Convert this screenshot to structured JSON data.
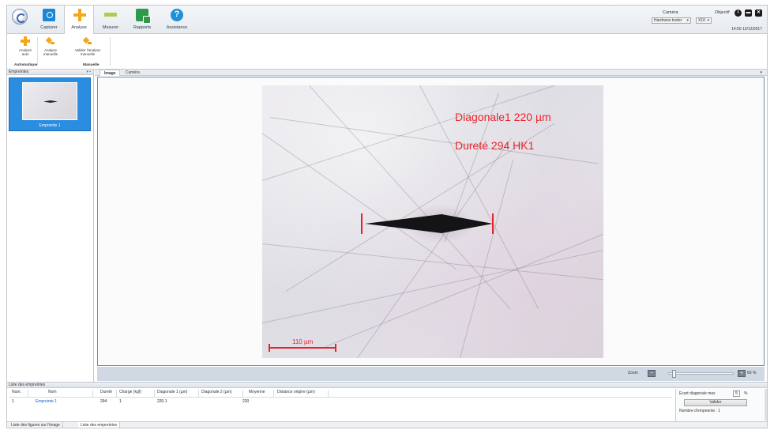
{
  "main_tabs": [
    {
      "label": "Capturer",
      "icon": "camera-icon"
    },
    {
      "label": "Analyse",
      "icon": "crosshair-icon"
    },
    {
      "label": "Mesurer",
      "icon": "ruler-icon"
    },
    {
      "label": "Rapports",
      "icon": "report-icon"
    },
    {
      "label": "Assistance",
      "icon": "help-icon"
    }
  ],
  "header": {
    "camera_label": "Caméra",
    "camera_value": "Hardness tester",
    "objectif_label": "Objectif",
    "objectif_value": "X10",
    "timestamp": "14:50 12/12/2017"
  },
  "ribbon": {
    "buttons": [
      {
        "label": "Analyse\nauto",
        "icon": "auto-analysis-icon"
      },
      {
        "label": "Analyse\nmanuelle",
        "icon": "manual-analysis-icon"
      },
      {
        "label": "Valider l'analyse\nmanuelle",
        "icon": "validate-analysis-icon"
      }
    ],
    "groups": [
      "Automatique",
      "Manuelle"
    ]
  },
  "left_panel": {
    "title": "Empreintes",
    "thumbnail_label": "Empreinte 1"
  },
  "image_tabs": [
    "Image",
    "Caméra"
  ],
  "image_overlay": {
    "line1": "Diagonale1 220 µm",
    "line2": "Dureté 294 HK1",
    "scale_label": "110 µm"
  },
  "zoom": {
    "label": "Zoom",
    "minus": "−",
    "plus": "+",
    "percent_text": "60 %",
    "level": 0.05
  },
  "bottom": {
    "title": "Liste des empreintes",
    "columns": [
      "Num.",
      "Nom",
      "Dureté",
      "Charge (kgf)",
      "Diagonale 1 (µm)",
      "Diagonale 2 (µm)",
      "Moyenne",
      "Distance origine (µm)"
    ],
    "rows": [
      [
        "1",
        "Empreinte 1",
        "294",
        "1",
        "220.1",
        "",
        "220",
        ""
      ]
    ],
    "ecart_label": "Ecart diagonale max",
    "ecart_value": "5",
    "ecart_unit": "%",
    "valider_label": "Valider",
    "nb_label": "Nombre d'empreinte : 1"
  },
  "bottom_tabs": [
    "Liste des figures sur l'image",
    "Liste des empreintes"
  ],
  "colors": {
    "accent": "#2a8de0",
    "measure_red": "#e8242a"
  }
}
